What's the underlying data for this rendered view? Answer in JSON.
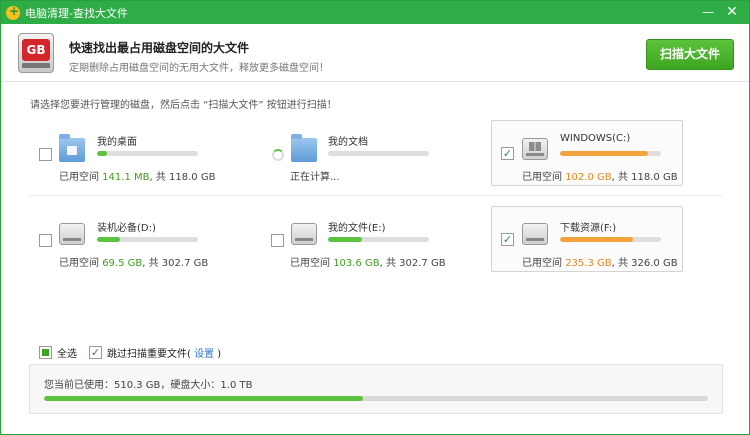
{
  "window": {
    "title": "电脑清理-查找大文件",
    "minimize_glyph": "—",
    "close_glyph": "✕"
  },
  "header": {
    "icon_text": "GB",
    "title": "快速找出最占用磁盘空间的大文件",
    "subtitle": "定期删除占用磁盘空间的无用大文件，释放更多磁盘空间！",
    "scan_button": "扫描大文件"
  },
  "instruction": "请选择您要进行管理的磁盘，然后点击 “扫描大文件” 按钮进行扫描！",
  "usage_prefix": "已用空间",
  "total_sep": ", 共",
  "drives": [
    {
      "name": "我的桌面",
      "checked": false,
      "selected": false,
      "icon": "desktop-folder-icon",
      "fill": 0.1,
      "used": "141.1 MB",
      "total": "118.0 GB",
      "color": "#5dc23d"
    },
    {
      "name": "我的文档",
      "checked": null,
      "selected": false,
      "icon": "documents-folder-icon",
      "fill": 0,
      "status": "正在计算...",
      "color": "#5dc23d"
    },
    {
      "name": "WINDOWS(C:)",
      "checked": true,
      "selected": true,
      "icon": "windows-drive-icon",
      "fill": 0.87,
      "used": "102.0 GB",
      "total": "118.0 GB",
      "color": "#f3a33c"
    },
    {
      "name": "装机必备(D:)",
      "checked": false,
      "selected": false,
      "icon": "hard-drive-icon",
      "fill": 0.23,
      "used": "69.5 GB",
      "total": "302.7 GB",
      "color": "#5dc23d"
    },
    {
      "name": "我的文件(E:)",
      "checked": false,
      "selected": false,
      "icon": "hard-drive-icon",
      "fill": 0.34,
      "used": "103.6 GB",
      "total": "302.7 GB",
      "color": "#5dc23d"
    },
    {
      "name": "下载资源(F:)",
      "checked": true,
      "selected": true,
      "icon": "hard-drive-icon",
      "fill": 0.72,
      "used": "235.3 GB",
      "total": "326.0 GB",
      "color": "#f3a33c"
    }
  ],
  "footer": {
    "select_all": "全选",
    "skip_label": "跳过扫描重要文件(",
    "settings_link": "设置",
    "skip_close": ")"
  },
  "summary": {
    "text": "您当前已使用：510.3 GB，硬盘大小：1.0 TB",
    "fill": 0.48
  },
  "colors": {
    "accent_green": "#2eac46",
    "used_green": "#3f9e1e",
    "used_orange": "#e6881a"
  }
}
